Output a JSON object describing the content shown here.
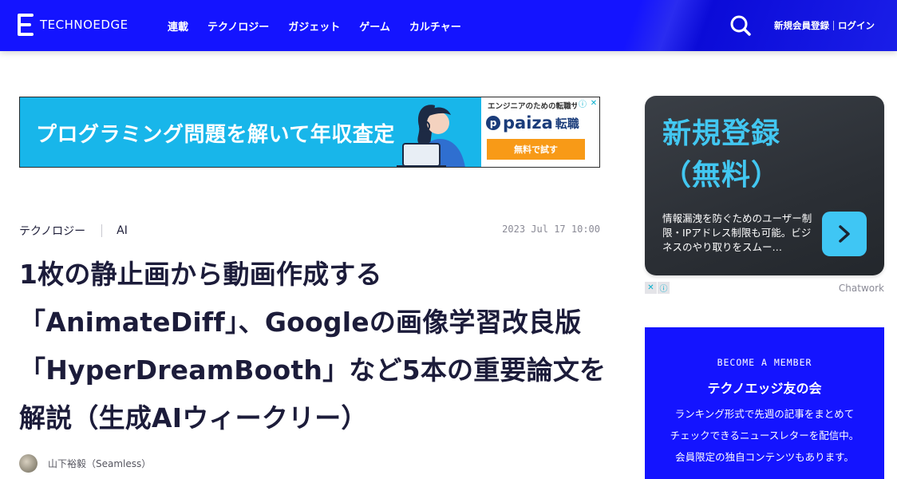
{
  "header": {
    "logo_text": "TECHNOEDGE",
    "nav": [
      "連載",
      "テクノロジー",
      "ガジェット",
      "ゲーム",
      "カルチャー"
    ],
    "signup_label": "新規会員登録",
    "login_label": "ログイン",
    "colors": {
      "brand": "#1414ff"
    }
  },
  "ad_banner": {
    "headline": "プログラミング問題を解いて年収査定",
    "sub_text": "エンジニアのための転職サ…",
    "brand": "paiza",
    "brand_suffix": "転職",
    "cta": "無料で試す",
    "colors": {
      "background": "#18b6ea",
      "cta": "#f89a17"
    }
  },
  "article": {
    "category": "テクノロジー",
    "tag": "AI",
    "date": "2023 Jul 17 10:00",
    "title_lines": [
      "1枚の静止画から動画作成する",
      "「AnimateDiff」、Googleの画像学習改良版",
      "「HyperDreamBooth」など5本の重要論文を",
      "解説（生成AIウィークリー）"
    ],
    "author": "山下裕毅（Seamless）"
  },
  "side_ad": {
    "headline_line1": "新規登録",
    "headline_line2": "（無料）",
    "description": "情報漏洩を防ぐためのユーザー制限・IPアドレス制限も可能。ビジネスのやり取りをスムー…",
    "brand": "Chatwork",
    "colors": {
      "accent": "#42c7f1"
    }
  },
  "member_box": {
    "eyebrow": "BECOME A MEMBER",
    "title": "テクノエッジ友の会",
    "body_lines": [
      "ランキング形式で先週の記事をまとめて",
      "チェックできるニュースレターを配信中。",
      "会員限定の独自コンテンツもあります。"
    ]
  }
}
